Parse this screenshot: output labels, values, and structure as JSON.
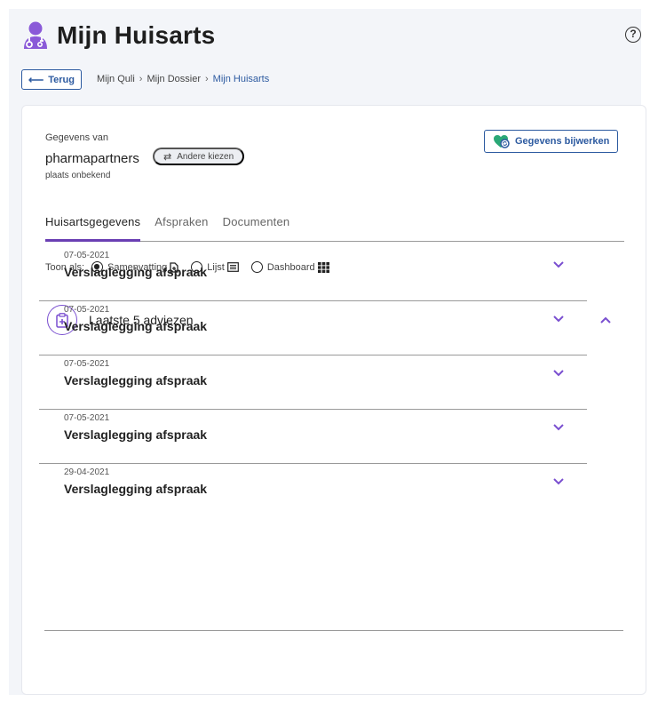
{
  "header": {
    "title": "Mijn Huisarts",
    "icon": "doctor-icon",
    "help_symbol": "?"
  },
  "navigation": {
    "back_label": "Terug",
    "breadcrumb": [
      "Mijn Quli",
      "Mijn Dossier",
      "Mijn Huisarts"
    ]
  },
  "practice": {
    "data_label": "Gegevens van",
    "name": "pharmapartners",
    "choose_other_label": "Andere kiezen",
    "location": "plaats onbekend",
    "update_label": "Gegevens bijwerken"
  },
  "tabs": [
    {
      "label": "Huisartsgegevens",
      "active": true
    },
    {
      "label": "Afspraken",
      "active": false
    },
    {
      "label": "Documenten",
      "active": false
    }
  ],
  "view_toggle": {
    "label": "Toon als:",
    "options": [
      {
        "label": "Samenvatting",
        "checked": true,
        "icon": "document-icon"
      },
      {
        "label": "Lijst",
        "checked": false,
        "icon": "list-icon"
      },
      {
        "label": "Dashboard",
        "checked": false,
        "icon": "grid-icon"
      }
    ]
  },
  "advice_section": {
    "title": "Laatste 5 adviezen",
    "items": [
      {
        "date": "07-05-2021",
        "title": "Verslaglegging afspraak"
      },
      {
        "date": "07-05-2021",
        "title": "Verslaglegging afspraak"
      },
      {
        "date": "07-05-2021",
        "title": "Verslaglegging afspraak"
      },
      {
        "date": "07-05-2021",
        "title": "Verslaglegging afspraak"
      },
      {
        "date": "29-04-2021",
        "title": "Verslaglegging afspraak"
      }
    ]
  },
  "colors": {
    "accent": "#7a4fd0",
    "link": "#2c5aa0",
    "tab_underline": "#6a3fb3",
    "background": "#f3f5f9"
  }
}
